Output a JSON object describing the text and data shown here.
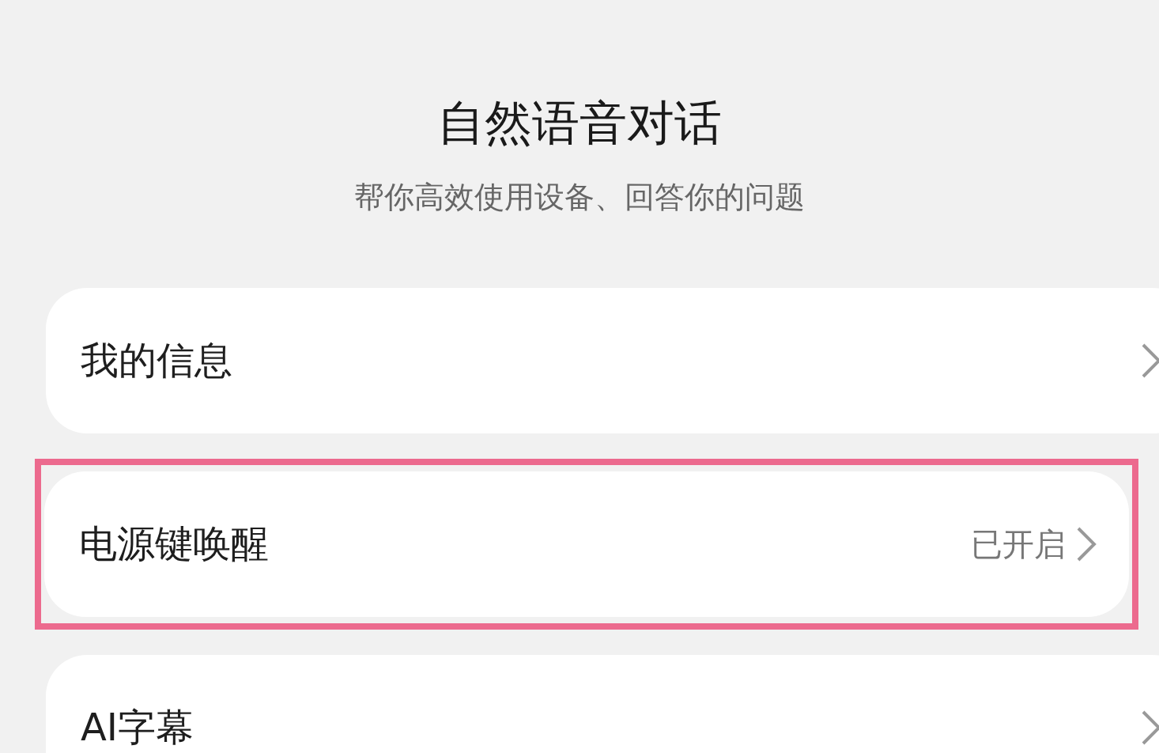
{
  "header": {
    "title": "自然语音对话",
    "subtitle": "帮你高效使用设备、回答你的问题"
  },
  "items": [
    {
      "label": "我的信息",
      "highlighted": false
    },
    {
      "label": "电源键唤醒",
      "value": "已开启",
      "highlighted": true
    },
    {
      "label": "AI字幕",
      "highlighted": false
    }
  ]
}
